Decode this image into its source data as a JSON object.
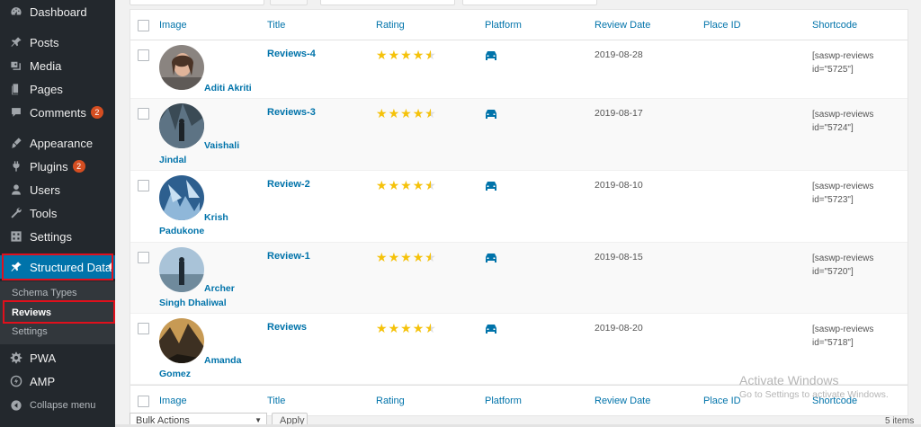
{
  "sidebar": {
    "items": [
      {
        "label": "Dashboard",
        "icon": "dashboard-icon"
      },
      {
        "label": "Posts",
        "icon": "pin-icon"
      },
      {
        "label": "Media",
        "icon": "media-icon"
      },
      {
        "label": "Pages",
        "icon": "pages-icon"
      },
      {
        "label": "Comments",
        "icon": "comment-icon",
        "badge": "2"
      },
      {
        "label": "Appearance",
        "icon": "brush-icon"
      },
      {
        "label": "Plugins",
        "icon": "plug-icon",
        "badge": "2"
      },
      {
        "label": "Users",
        "icon": "user-icon"
      },
      {
        "label": "Tools",
        "icon": "wrench-icon"
      },
      {
        "label": "Settings",
        "icon": "settings-icon"
      },
      {
        "label": "Structured Data",
        "icon": "pin-icon"
      },
      {
        "label": "PWA",
        "icon": "gear-icon"
      },
      {
        "label": "AMP",
        "icon": "bolt-icon"
      },
      {
        "label": "Collapse menu",
        "icon": "collapse-icon"
      }
    ],
    "submenu": [
      {
        "label": "Schema Types"
      },
      {
        "label": "Reviews"
      },
      {
        "label": "Settings"
      }
    ]
  },
  "table": {
    "columns": [
      "Image",
      "Title",
      "Rating",
      "Platform",
      "Review Date",
      "Place ID",
      "Shortcode"
    ],
    "rows": [
      {
        "name_line1": "Aditi Akriti",
        "name_line2": "",
        "title": "Reviews-4",
        "rating": 4.5,
        "date": "2019-08-28",
        "place_id": "",
        "shortcode_1": "[saswp-reviews",
        "shortcode_2": "id=\"5725\"]"
      },
      {
        "name_line1": "Vaishali",
        "name_line2": "Jindal",
        "title": "Reviews-3",
        "rating": 4.5,
        "date": "2019-08-17",
        "place_id": "",
        "shortcode_1": "[saswp-reviews",
        "shortcode_2": "id=\"5724\"]"
      },
      {
        "name_line1": "Krish",
        "name_line2": "Padukone",
        "title": "Review-2",
        "rating": 4.5,
        "date": "2019-08-10",
        "place_id": "",
        "shortcode_1": "[saswp-reviews",
        "shortcode_2": "id=\"5723\"]"
      },
      {
        "name_line1": "Archer",
        "name_line2": "Singh Dhaliwal",
        "title": "Review-1",
        "rating": 4.5,
        "date": "2019-08-15",
        "place_id": "",
        "shortcode_1": "[saswp-reviews",
        "shortcode_2": "id=\"5720\"]"
      },
      {
        "name_line1": "Amanda",
        "name_line2": "Gomez",
        "title": "Reviews",
        "rating": 4.5,
        "date": "2019-08-20",
        "place_id": "",
        "shortcode_1": "[saswp-reviews",
        "shortcode_2": "id=\"5718\"]"
      }
    ]
  },
  "bulk_actions": {
    "label": "Bulk Actions"
  },
  "apply_label": "Apply",
  "items_count": "5 items",
  "watermark": {
    "line1": "Activate Windows",
    "line2": "Go to Settings to activate Windows."
  },
  "colors": {
    "sidebar": "#23282d",
    "accent": "#0073aa",
    "highlight": "#e0101c",
    "star": "#f5c20a"
  }
}
